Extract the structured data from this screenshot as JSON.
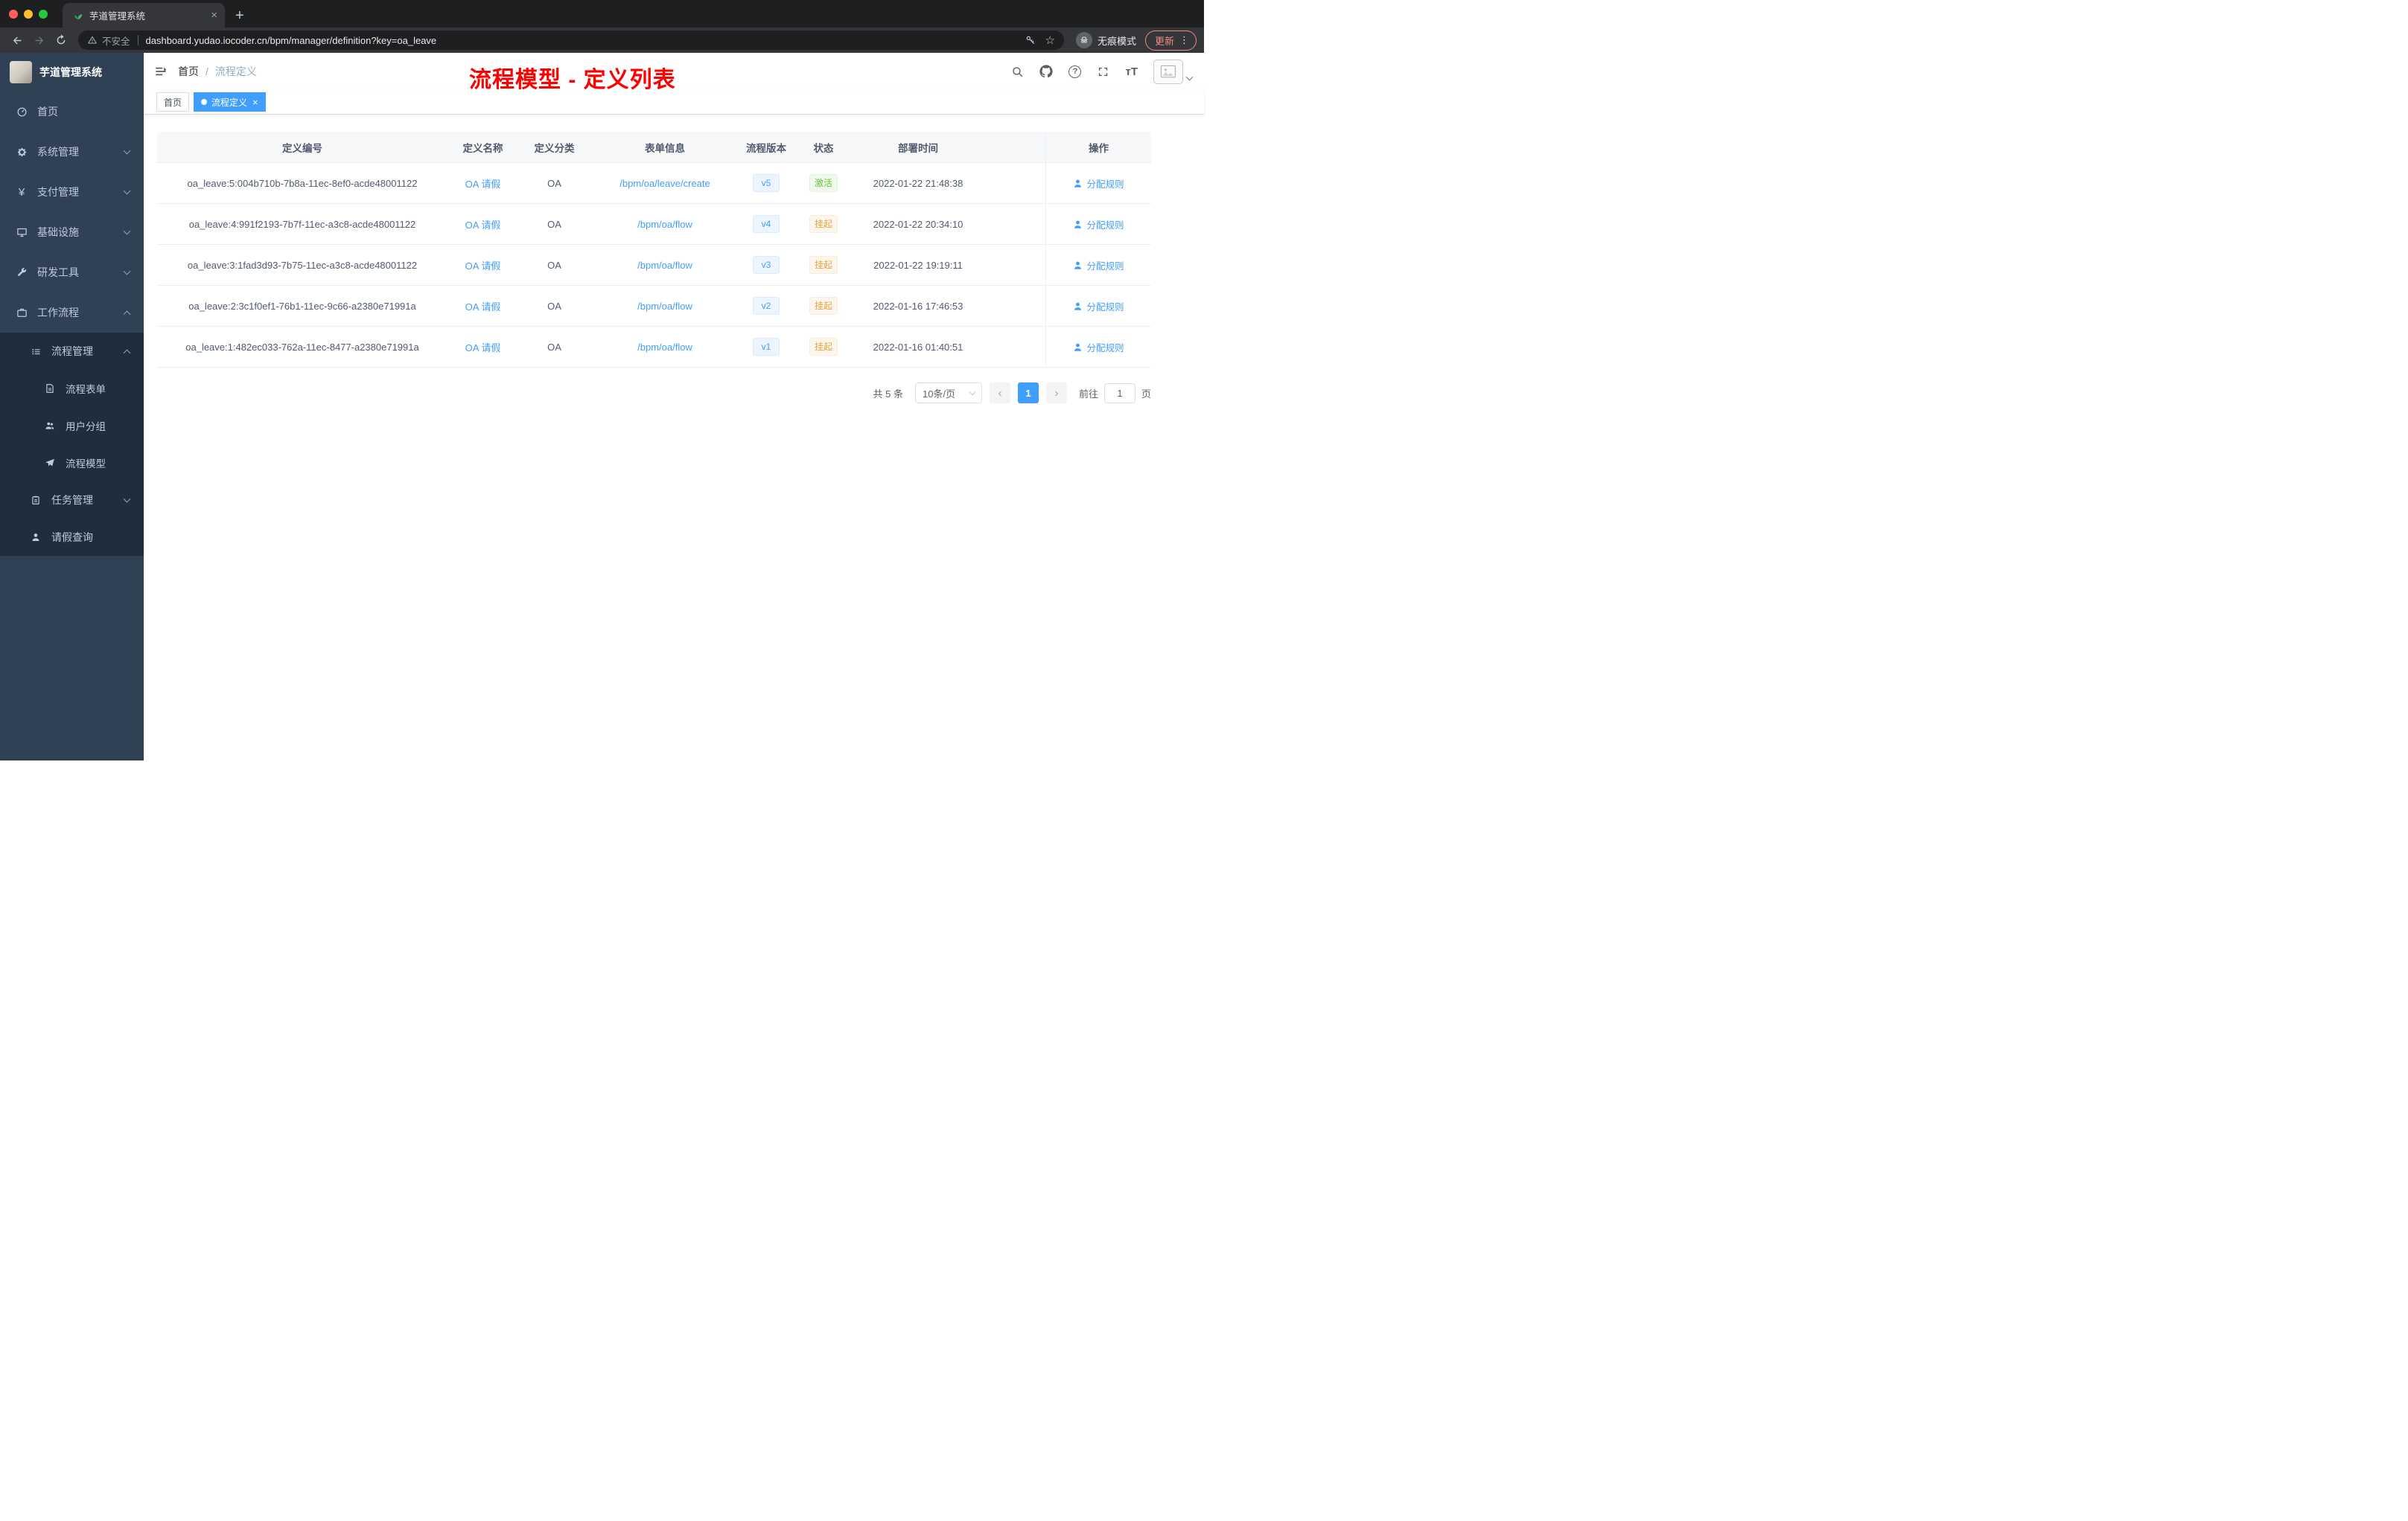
{
  "browser": {
    "tab": {
      "title": "芋道管理系统",
      "close_glyph": "×"
    },
    "new_tab_glyph": "+",
    "address_bar": {
      "security_label": "不安全",
      "url": "dashboard.yudao.iocoder.cn/bpm/manager/definition?key=oa_leave"
    },
    "incognito_label": "无痕模式",
    "update_button": "更新",
    "kebab_glyph": "⋮",
    "star_glyph": "☆"
  },
  "sidebar": {
    "logo_title": "芋道管理系统",
    "menu": [
      {
        "label": "首页"
      },
      {
        "label": "系统管理"
      },
      {
        "label": "支付管理"
      },
      {
        "label": "基础设施"
      },
      {
        "label": "研发工具"
      },
      {
        "label": "工作流程"
      }
    ],
    "submenu": [
      {
        "label": "流程管理"
      },
      {
        "label": "流程表单"
      },
      {
        "label": "用户分组"
      },
      {
        "label": "流程模型"
      },
      {
        "label": "任务管理"
      },
      {
        "label": "请假查询"
      }
    ],
    "yen_glyph": "¥"
  },
  "navbar": {
    "breadcrumb": {
      "home": "首页",
      "separator": "/",
      "current": "流程定义"
    },
    "annotation": "流程模型 - 定义列表",
    "question_glyph": "?",
    "fontsize_glyph": "тT"
  },
  "tags_view": [
    {
      "label": "首页"
    },
    {
      "label": "流程定义",
      "close_glyph": "×"
    }
  ],
  "table": {
    "columns": {
      "id": "定义编号",
      "name": "定义名称",
      "category": "定义分类",
      "form": "表单信息",
      "version": "流程版本",
      "status": "状态",
      "deploy_time": "部署时间",
      "actions": "操作"
    },
    "rows": [
      {
        "id": "oa_leave:5:004b710b-7b8a-11ec-8ef0-acde48001122",
        "name": "OA 请假",
        "category": "OA",
        "form": "/bpm/oa/leave/create",
        "version": "v5",
        "status": "激活",
        "status_type": "success",
        "deploy_time": "2022-01-22 21:48:38",
        "action": "分配规则"
      },
      {
        "id": "oa_leave:4:991f2193-7b7f-11ec-a3c8-acde48001122",
        "name": "OA 请假",
        "category": "OA",
        "form": "/bpm/oa/flow",
        "version": "v4",
        "status": "挂起",
        "status_type": "warning",
        "deploy_time": "2022-01-22 20:34:10",
        "action": "分配规则"
      },
      {
        "id": "oa_leave:3:1fad3d93-7b75-11ec-a3c8-acde48001122",
        "name": "OA 请假",
        "category": "OA",
        "form": "/bpm/oa/flow",
        "version": "v3",
        "status": "挂起",
        "status_type": "warning",
        "deploy_time": "2022-01-22 19:19:11",
        "action": "分配规则"
      },
      {
        "id": "oa_leave:2:3c1f0ef1-76b1-11ec-9c66-a2380e71991a",
        "name": "OA 请假",
        "category": "OA",
        "form": "/bpm/oa/flow",
        "version": "v2",
        "status": "挂起",
        "status_type": "warning",
        "deploy_time": "2022-01-16 17:46:53",
        "action": "分配规则"
      },
      {
        "id": "oa_leave:1:482ec033-762a-11ec-8477-a2380e71991a",
        "name": "OA 请假",
        "category": "OA",
        "form": "/bpm/oa/flow",
        "version": "v1",
        "status": "挂起",
        "status_type": "warning",
        "deploy_time": "2022-01-16 01:40:51",
        "action": "分配规则"
      }
    ]
  },
  "pagination": {
    "total": "共 5 条",
    "page_size": "10条/页",
    "prev_glyph": "‹",
    "page": "1",
    "next_glyph": "›",
    "goto_label": "前往",
    "goto_value": "1",
    "unit_label": "页"
  },
  "colors": {
    "primary": "#409eff",
    "success": "#67c23a",
    "warning": "#e6a23c",
    "annotation_red": "#fe0000",
    "sidebar_bg": "#304156",
    "submenu_bg": "#1f2d3d"
  }
}
